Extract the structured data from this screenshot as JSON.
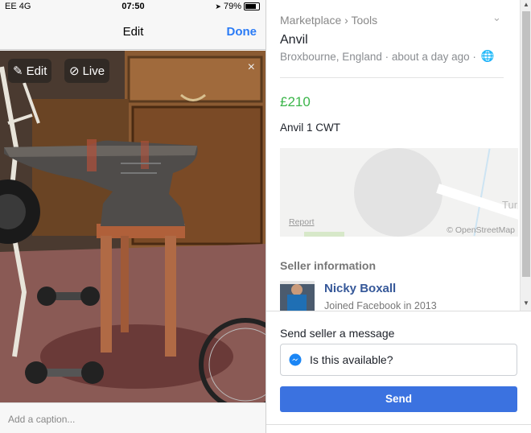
{
  "phone": {
    "status": {
      "carrier": "EE  4G",
      "time": "07:50",
      "battery": "79%",
      "battery_level": 0.79
    },
    "nav": {
      "title": "Edit",
      "done": "Done"
    },
    "photo": {
      "edit": "Edit",
      "live": "Live",
      "close": "×"
    },
    "caption_placeholder": "Add a caption..."
  },
  "listing": {
    "breadcrumb": "Marketplace › Tools",
    "title": "Anvil",
    "location": "Broxbourne, England · about a day ago ·",
    "price": "£210",
    "description": "Anvil 1 CWT",
    "map": {
      "report": "Report",
      "attribution": "© OpenStreetMap",
      "town": "Tur"
    },
    "seller_heading": "Seller information",
    "seller_name": "Nicky Boxall",
    "seller_joined": "Joined Facebook in 2013"
  },
  "message": {
    "heading": "Send seller a message",
    "value": "Is this available?",
    "send": "Send"
  },
  "colors": {
    "price": "#3bb54a",
    "link": "#365899",
    "send_button": "#3b72e0",
    "done": "#2a7bf6"
  }
}
